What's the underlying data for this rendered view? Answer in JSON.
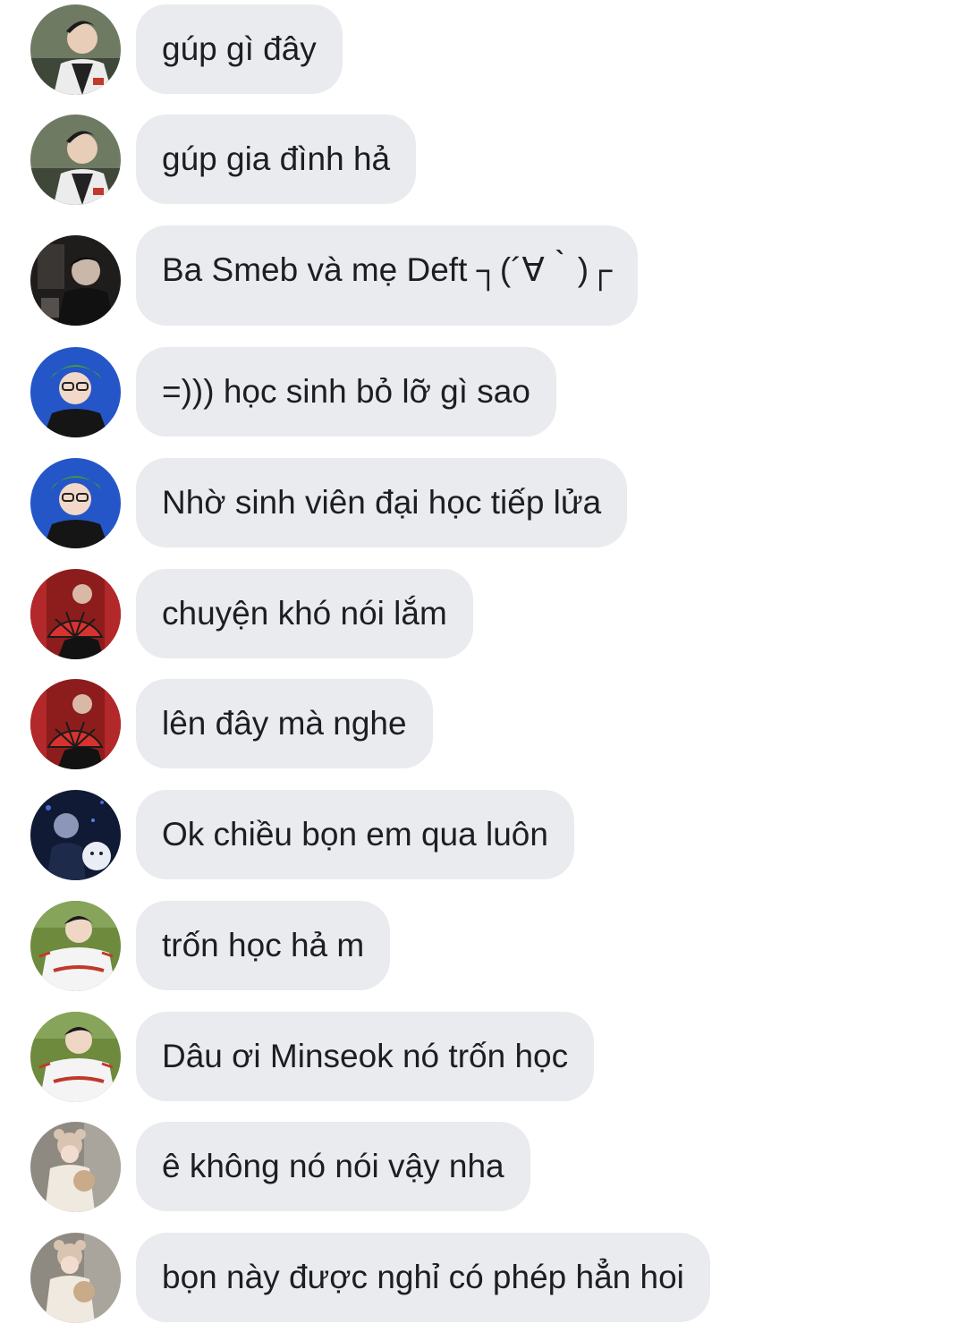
{
  "messages": [
    {
      "text": "gúp gì đây",
      "avatar": "avatar-a"
    },
    {
      "text": "gúp gia đình hả",
      "avatar": "avatar-a"
    },
    {
      "text": "Ba Smeb và mẹ Deft ┐(´∀｀)┌",
      "avatar": "avatar-b"
    },
    {
      "text": "=))) học sinh bỏ lỡ gì sao",
      "avatar": "avatar-c"
    },
    {
      "text": "Nhờ sinh viên đại học tiếp lửa",
      "avatar": "avatar-c"
    },
    {
      "text": "chuyện khó nói lắm",
      "avatar": "avatar-d"
    },
    {
      "text": "lên đây mà nghe",
      "avatar": "avatar-d"
    },
    {
      "text": "Ok chiều bọn em qua luôn",
      "avatar": "avatar-e"
    },
    {
      "text": "trốn học hả m",
      "avatar": "avatar-f"
    },
    {
      "text": "Dâu ơi Minseok nó trốn học",
      "avatar": "avatar-f"
    },
    {
      "text": "ê không nó nói vậy nha",
      "avatar": "avatar-g"
    },
    {
      "text": "bọn này được nghỉ có phép hẳn hoi",
      "avatar": "avatar-g"
    }
  ],
  "colors": {
    "bubble": "#e9ebee",
    "text": "#1c1e21",
    "background": "#ffffff"
  }
}
